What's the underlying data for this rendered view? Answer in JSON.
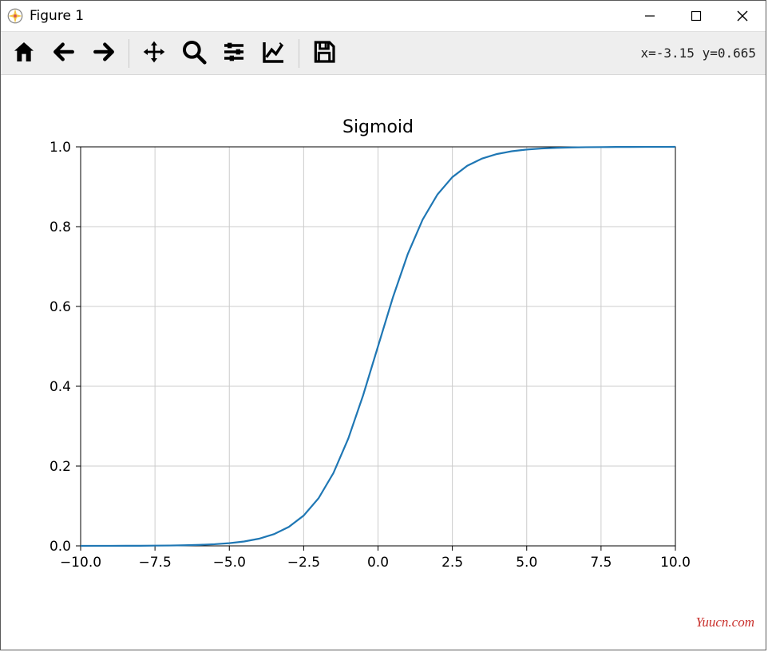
{
  "window": {
    "title": "Figure 1"
  },
  "toolbar": {
    "coords": "x=-3.15 y=0.665"
  },
  "watermark": "Yuucn.com",
  "chart_data": {
    "type": "line",
    "title": "Sigmoid",
    "xlabel": "",
    "ylabel": "",
    "xlim": [
      -10,
      10
    ],
    "ylim": [
      0,
      1
    ],
    "xticks": [
      -10.0,
      -7.5,
      -5.0,
      -2.5,
      0.0,
      2.5,
      5.0,
      7.5,
      10.0
    ],
    "yticks": [
      0.0,
      0.2,
      0.4,
      0.6,
      0.8,
      1.0
    ],
    "grid": true,
    "x": [
      -10,
      -9.5,
      -9,
      -8.5,
      -8,
      -7.5,
      -7,
      -6.5,
      -6,
      -5.5,
      -5,
      -4.5,
      -4,
      -3.5,
      -3,
      -2.5,
      -2,
      -1.5,
      -1,
      -0.5,
      0,
      0.5,
      1,
      1.5,
      2,
      2.5,
      3,
      3.5,
      4,
      4.5,
      5,
      5.5,
      6,
      6.5,
      7,
      7.5,
      8,
      8.5,
      9,
      9.5,
      10
    ],
    "y": [
      0.0,
      0.0001,
      0.0001,
      0.0002,
      0.0003,
      0.0006,
      0.0009,
      0.0015,
      0.0025,
      0.0041,
      0.0067,
      0.011,
      0.018,
      0.0293,
      0.0474,
      0.0759,
      0.1192,
      0.1824,
      0.2689,
      0.3775,
      0.5,
      0.6225,
      0.7311,
      0.8176,
      0.8808,
      0.9241,
      0.9526,
      0.9707,
      0.982,
      0.989,
      0.9933,
      0.9959,
      0.9975,
      0.9985,
      0.9991,
      0.9994,
      0.9997,
      0.9998,
      0.9999,
      0.9999,
      1.0
    ]
  }
}
